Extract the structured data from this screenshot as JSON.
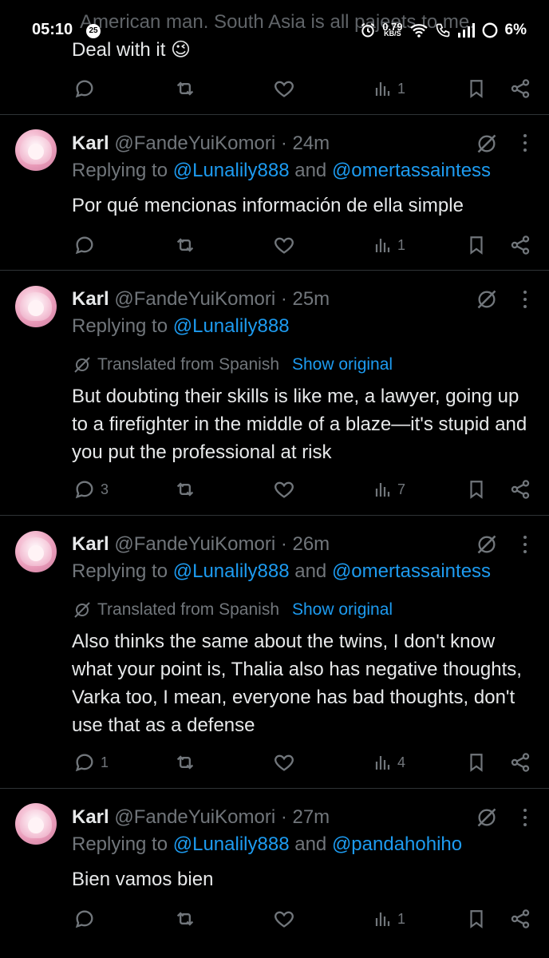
{
  "status_bar": {
    "time": "05:10",
    "badge": "25",
    "speed_value": "0.79",
    "speed_unit": "KB/S",
    "battery": "6%"
  },
  "previous_tweet": {
    "faded_line": "American man. South Asia is all pajeets to me.",
    "last_line": "Deal with it 😉",
    "actions": {
      "replies": "",
      "reposts": "",
      "likes": "",
      "views": "1"
    }
  },
  "tweets": [
    {
      "name": "Karl",
      "handle": "@FandeYuiKomori",
      "time": "· 24m",
      "replying_prefix": "Replying to ",
      "mention1": "@Lunalily888",
      "and": " and ",
      "mention2": "@omertassaintess",
      "translated": "",
      "show_original": "",
      "body": "Por qué mencionas información de ella simple",
      "actions": {
        "replies": "",
        "views": "1"
      }
    },
    {
      "name": "Karl",
      "handle": "@FandeYuiKomori",
      "time": "· 25m",
      "replying_prefix": "Replying to ",
      "mention1": "@Lunalily888",
      "and": "",
      "mention2": "",
      "translated": "Translated from Spanish",
      "show_original": "Show original",
      "body": "But doubting their skills is like me, a lawyer, going up to a firefighter in the middle of a blaze—it's stupid and you put the professional at risk",
      "actions": {
        "replies": "3",
        "views": "7"
      }
    },
    {
      "name": "Karl",
      "handle": "@FandeYuiKomori",
      "time": "· 26m",
      "replying_prefix": "Replying to ",
      "mention1": "@Lunalily888",
      "and": " and ",
      "mention2": "@omertassaintess",
      "translated": "Translated from Spanish",
      "show_original": "Show original",
      "body": "Also thinks the same about the twins, I don't know what your point is, Thalia also has negative thoughts, Varka too, I mean, everyone has bad thoughts, don't use that as a defense",
      "actions": {
        "replies": "1",
        "views": "4"
      }
    },
    {
      "name": "Karl",
      "handle": "@FandeYuiKomori",
      "time": "· 27m",
      "replying_prefix": "Replying to ",
      "mention1": "@Lunalily888",
      "and": " and ",
      "mention2": "@pandahohiho",
      "translated": "",
      "show_original": "",
      "body": "Bien vamos bien",
      "actions": {
        "replies": "",
        "views": "1"
      }
    }
  ]
}
